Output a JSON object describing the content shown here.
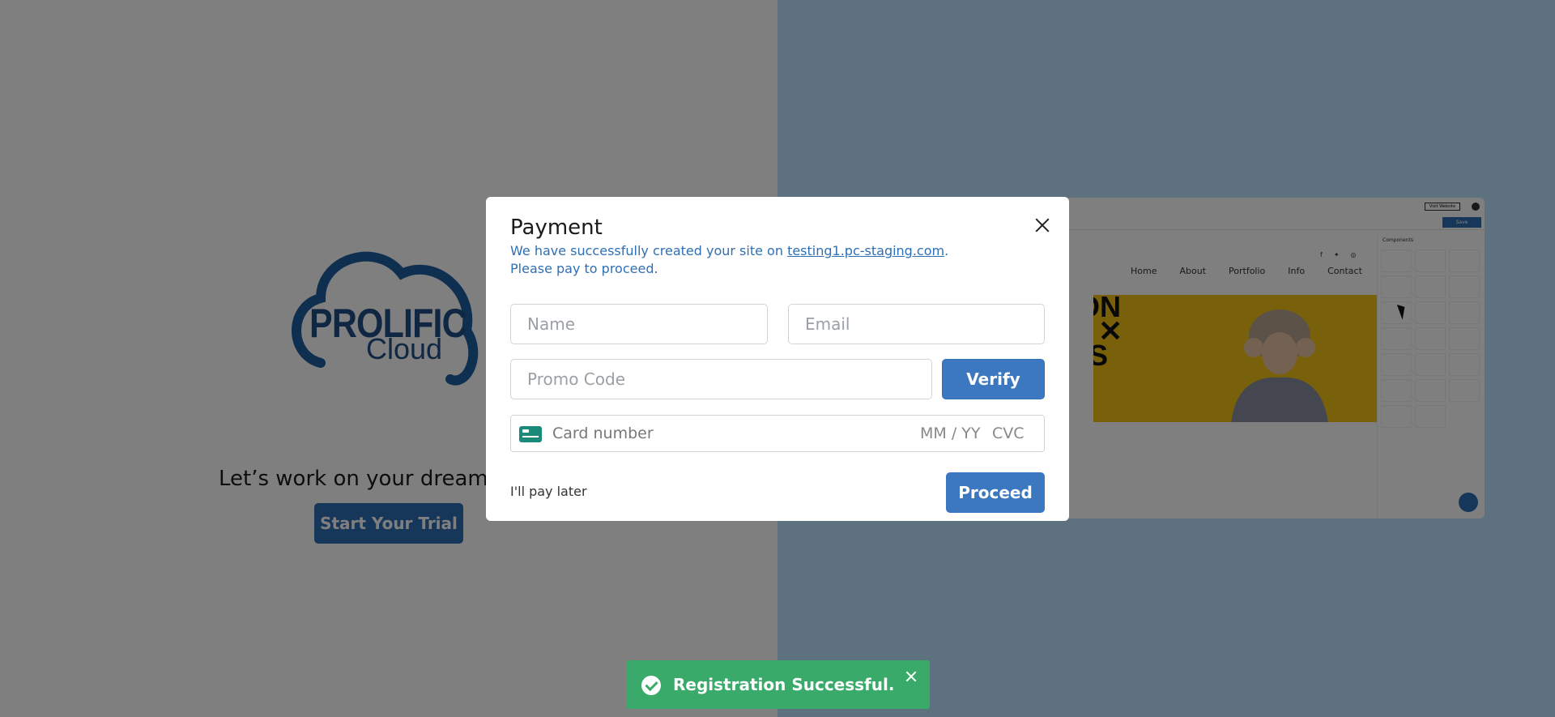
{
  "background": {
    "logo": {
      "line1": "PROLIFIC",
      "line2": "Cloud"
    },
    "tagline": "Let’s work on your dream website",
    "trial_button": "Start Your Trial",
    "preview": {
      "visit_label": "Visit Website",
      "save_label": "Save",
      "nav": [
        "Home",
        "About",
        "Portfolio",
        "Info",
        "Contact"
      ],
      "hero_text": "FASHION\nWINTER\nTIPS",
      "components_title": "Components"
    }
  },
  "modal": {
    "title": "Payment",
    "message_prefix": "We have successfully created your site on ",
    "site_link": "testing1.pc-staging.com",
    "message_suffix": ".",
    "message_line2": "Please pay to proceed.",
    "name_placeholder": "Name",
    "email_placeholder": "Email",
    "promo_placeholder": "Promo Code",
    "verify_label": "Verify",
    "card_number_placeholder": "Card number",
    "card_expiry_placeholder": "MM / YY",
    "card_cvc_placeholder": "CVC",
    "pay_later_label": "I'll pay later",
    "proceed_label": "Proceed"
  },
  "toast": {
    "message": "Registration Successful."
  },
  "colors": {
    "primary": "#3b78c0",
    "success": "#3aaa6a",
    "link": "#2f6fb4"
  }
}
